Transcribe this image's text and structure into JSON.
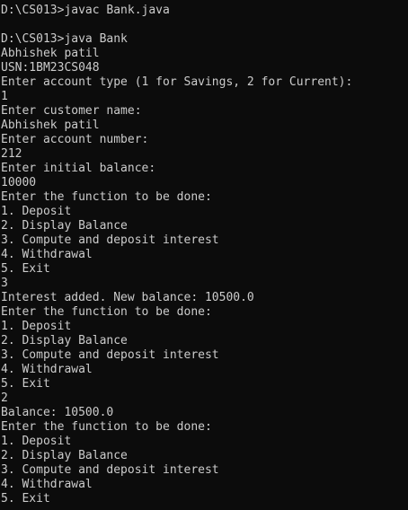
{
  "console": {
    "lines": [
      "D:\\CS013>javac Bank.java",
      "",
      "D:\\CS013>java Bank",
      "Abhishek patil",
      "USN:1BM23CS048",
      "Enter account type (1 for Savings, 2 for Current):",
      "1",
      "Enter customer name:",
      "Abhishek patil",
      "Enter account number:",
      "212",
      "Enter initial balance:",
      "10000",
      "Enter the function to be done:",
      "1. Deposit",
      "2. Display Balance",
      "3. Compute and deposit interest",
      "4. Withdrawal",
      "5. Exit",
      "3",
      "Interest added. New balance: 10500.0",
      "Enter the function to be done:",
      "1. Deposit",
      "2. Display Balance",
      "3. Compute and deposit interest",
      "4. Withdrawal",
      "5. Exit",
      "2",
      "Balance: 10500.0",
      "Enter the function to be done:",
      "1. Deposit",
      "2. Display Balance",
      "3. Compute and deposit interest",
      "4. Withdrawal",
      "5. Exit"
    ]
  }
}
